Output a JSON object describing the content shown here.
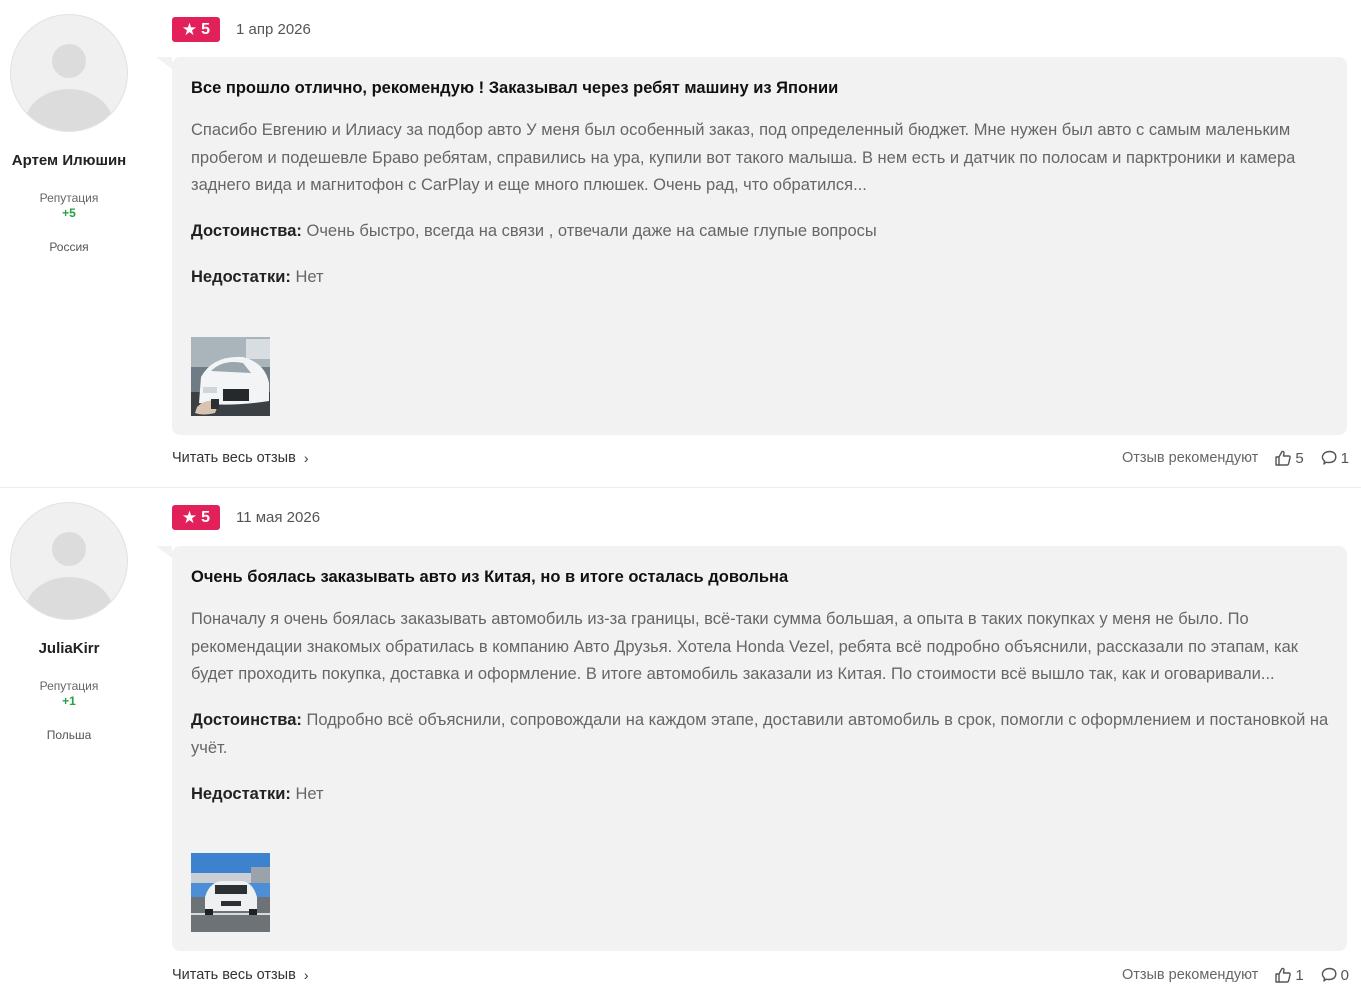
{
  "reviews": [
    {
      "author": "Артем Илюшин",
      "reputation_label": "Репутация",
      "reputation": "+5",
      "country": "Россия",
      "rating": "5",
      "date": "1 апр 2026",
      "title": "Все прошло отлично, рекомендую ! Заказывал через ребят машину из Японии",
      "text": "Спасибо Евгению и Илиасу за подбор авто У меня был особенный заказ, под определенный бюджет. Мне нужен был авто с самым маленьким пробегом и подешевле Браво ребятам, справились на ура, купили вот такого малыша. В нем есть и датчик по полосам и парктроники и камера заднего вида и магнитофон с CarPlay и еще много плюшек. Очень рад, что обратился...",
      "pros_label": "Достоинства:",
      "pros": "Очень быстро, всегда на связи , отвечали даже на самые глупые вопросы",
      "cons_label": "Недостатки:",
      "cons": "Нет",
      "read_more": "Читать весь отзыв",
      "recommend_label": "Отзыв рекомендуют",
      "likes": "5",
      "comments": "1"
    },
    {
      "author": "JuliaKirr",
      "reputation_label": "Репутация",
      "reputation": "+1",
      "country": "Польша",
      "rating": "5",
      "date": "11 мая 2026",
      "title": "Очень боялась заказывать авто из Китая, но в итоге осталась довольна",
      "text": "Поначалу я очень боялась заказывать автомобиль из-за границы, всё-таки сумма большая, а опыта в таких покупках у меня не было. По рекомендации знакомых обратилась в компанию Авто Друзья. Хотела Honda Vezel, ребята всё подробно объяснили, рассказали по этапам, как будет проходить покупка, доставка и оформление. В итоге автомобиль заказали из Китая. По стоимости всё вышло так, как и оговаривали...",
      "pros_label": "Достоинства:",
      "pros": "Подробно всё объяснили, сопровождали на каждом этапе, доставили автомобиль в срок, помогли с оформлением и постановкой на учёт.",
      "cons_label": "Недостатки:",
      "cons": "Нет",
      "read_more": "Читать весь отзыв",
      "recommend_label": "Отзыв рекомендуют",
      "likes": "1",
      "comments": "0"
    }
  ],
  "colors": {
    "rating_badge": "#e2215a",
    "reputation_positive": "#25a244",
    "bubble_bg": "#f2f2f3"
  },
  "icons": {
    "rating": "star-icon",
    "like": "thumbs-up-icon",
    "comment": "comment-icon",
    "chevron": "chevron-right-icon"
  }
}
